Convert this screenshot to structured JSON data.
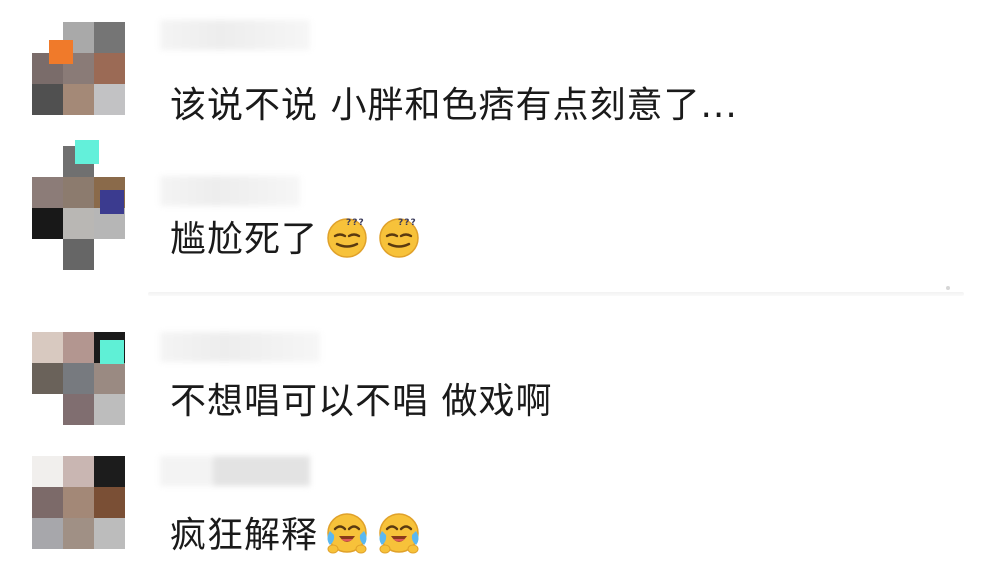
{
  "comments": [
    {
      "text": "该说不说 小胖和色痞有点刻意了...",
      "emojis": [],
      "avatar_colors": [
        "#a9a9a9",
        "#8e7b6f",
        "#757575",
        "#7a6c6a",
        "#8a7b77",
        "#9b6a55",
        "#505050",
        "#a48977",
        "#c2c2c4"
      ],
      "avatar_accent": "#f07a2a"
    },
    {
      "text": "尴尬死了",
      "emojis": [
        "dizzy-smile-emoji",
        "dizzy-smile-emoji"
      ],
      "avatar_colors": [
        "#ffffff",
        "#707070",
        "#ffffff",
        "#8c7c78",
        "#8c7b6e",
        "#8a6a4a",
        "#181818",
        "#b9b7b4",
        "#b6b6b6"
      ],
      "avatar_accent": "#63f0da",
      "avatar_accent2": "#3b3b8f"
    },
    {
      "text": "不想唱可以不唱 做戏啊",
      "emojis": [],
      "avatar_colors": [
        "#d8c9c0",
        "#b39690",
        "#1a1a1a",
        "#6a625a",
        "#777a7f",
        "#9a8a82",
        "#ffffff",
        "#806e70",
        "#bdbdbd"
      ],
      "avatar_accent": "#5ff0d6"
    },
    {
      "text": "疯狂解释",
      "emojis": [
        "crying-laugh-emoji",
        "crying-laugh-emoji"
      ],
      "avatar_colors": [
        "#f1efed",
        "#c9b6b2",
        "#1c1c1c",
        "#7c6a69",
        "#a38877",
        "#7a4f35",
        "#a7a7ab",
        "#a09085",
        "#bcbcbc"
      ],
      "avatar_accent": ""
    }
  ]
}
